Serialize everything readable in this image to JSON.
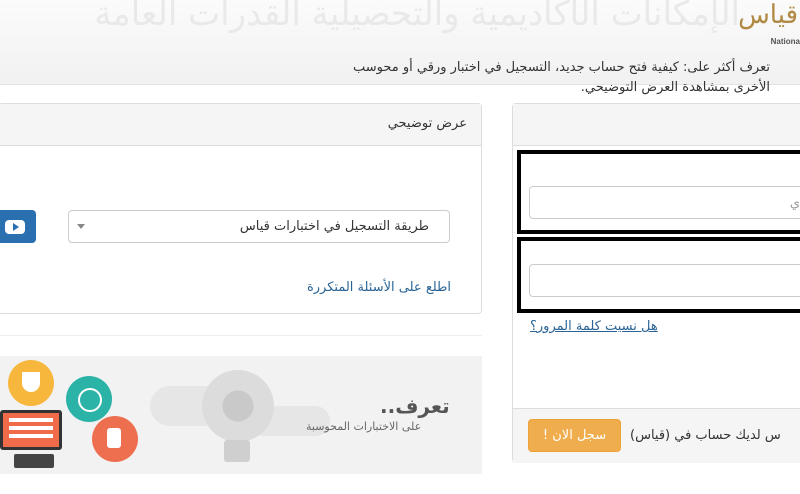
{
  "header": {
    "calligraphy_text": "الإمكانات الأكاديمية والتحصيلية القدرات العامة",
    "logo_glyph": "قياس",
    "logo_text": "Nationa"
  },
  "demo_panel": {
    "title": "عرض توضيحي",
    "description_line1": "تعرف أكثر على: كيفية فتح حساب جديد، التسجيل في اختبار ورقي أو محوسب",
    "description_line2": "الأخرى بمشاهدة العرض التوضيحي.",
    "select_value": "طريقة التسجيل في اختبارات قياس",
    "faq_link": "اطلع على الأسئلة المتكررة"
  },
  "banner": {
    "title": "تعرف..",
    "subtitle": "على الاختبارات المحوسبة"
  },
  "login_panel": {
    "username_placeholder": "ي",
    "forgot_password": "هل نسيت كلمة المرور؟",
    "no_account_text": "س لديك حساب في (قياس)",
    "register_button": "سجل الان !"
  },
  "colors": {
    "link": "#2a6496",
    "register_button": "#f0ad4e",
    "video_button": "#2a6fb0"
  }
}
